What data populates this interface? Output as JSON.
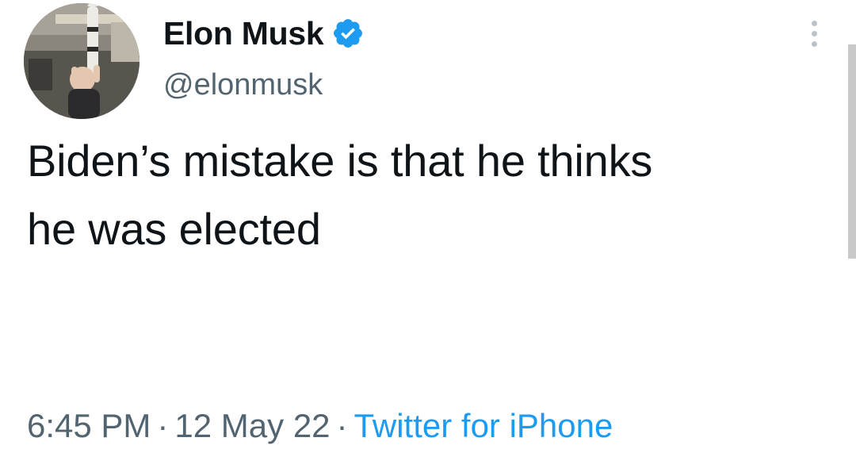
{
  "tweet": {
    "author": {
      "display_name": "Elon Musk",
      "handle": "@elonmusk",
      "verified": true,
      "avatar_icon": "profile-photo"
    },
    "text_lines": [
      "Biden’s mistake is that he thinks",
      "he was elected"
    ],
    "meta": {
      "time": "6:45 PM",
      "separator": "·",
      "date": "12 May 22",
      "source": "Twitter for iPhone"
    },
    "more_menu_icon": "more-options-icon"
  },
  "colors": {
    "text": "#0f1419",
    "secondary": "#536471",
    "accent": "#1d9bf0"
  }
}
